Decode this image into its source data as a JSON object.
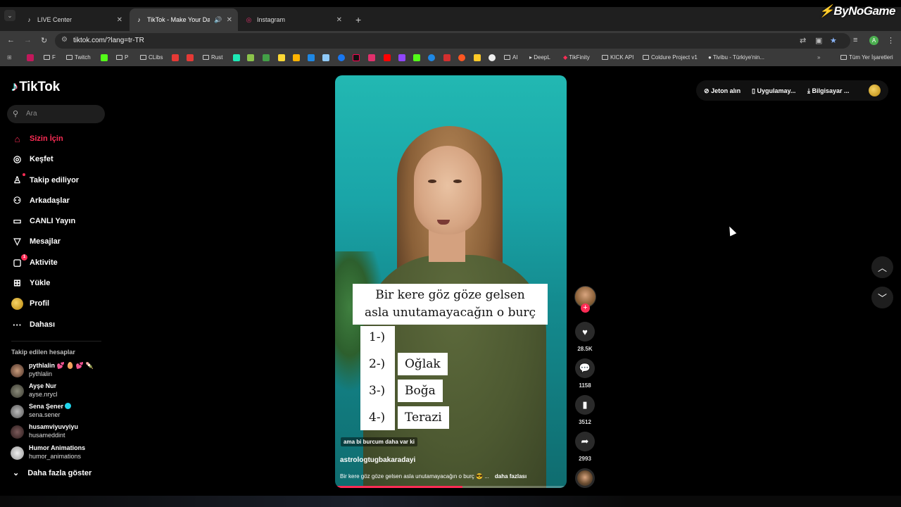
{
  "browser": {
    "tabs": [
      {
        "title": "LIVE Center",
        "icon": "tiktok-icon"
      },
      {
        "title": "TikTok - Make Your Day",
        "icon": "tiktok-icon",
        "active": true
      },
      {
        "title": "Instagram",
        "icon": "instagram-icon"
      }
    ],
    "url": "tiktok.com/?lang=tr-TR",
    "watermark": "ByNoGame",
    "bookmarks": [
      "F",
      "Twitch",
      "P",
      "CLibs",
      "Rust",
      "AI",
      "DeepL",
      "TikFinity",
      "KICK API",
      "Coldure Project v1",
      "Tivibu - Türkiye'nin...",
      "Tüm Yer İşaretleri"
    ],
    "profile_initial": "A"
  },
  "tiktok": {
    "logo": "TikTok",
    "search_placeholder": "Ara",
    "nav": [
      {
        "label": "Sizin İçin",
        "icon": "home-icon"
      },
      {
        "label": "Keşfet",
        "icon": "compass-icon"
      },
      {
        "label": "Takip ediliyor",
        "icon": "following-icon"
      },
      {
        "label": "Arkadaşlar",
        "icon": "friends-icon"
      },
      {
        "label": "CANLI Yayın",
        "icon": "live-icon"
      },
      {
        "label": "Mesajlar",
        "icon": "messages-icon"
      },
      {
        "label": "Aktivite",
        "icon": "activity-icon",
        "badge": "1"
      },
      {
        "label": "Yükle",
        "icon": "upload-icon"
      },
      {
        "label": "Profil",
        "icon": "profile-icon"
      },
      {
        "label": "Dahası",
        "icon": "more-icon"
      }
    ],
    "following_title": "Takip edilen hesaplar",
    "following": [
      {
        "name": "pythlalin 💕 🥚 💕 🍡",
        "handle": "pythlalin"
      },
      {
        "name": "Ayşe Nur",
        "handle": "ayse.nrycl"
      },
      {
        "name": "Sena Şener",
        "handle": "sena.sener",
        "verified": true
      },
      {
        "name": "husamviyuvyiyu",
        "handle": "husameddint"
      },
      {
        "name": "Humor Animations",
        "handle": "humor_animations"
      }
    ],
    "show_more": "Daha fazla göster",
    "header": {
      "coins": "Jeton alın",
      "app": "Uygulamay...",
      "desktop": "Bilgisayar ..."
    }
  },
  "video": {
    "title_line1": "Bir kere göz göze gelsen",
    "title_line2": "asla unutamayacağın o burç",
    "list": [
      {
        "num": "1-)",
        "answer": ""
      },
      {
        "num": "2-)",
        "answer": "Oğlak"
      },
      {
        "num": "3-)",
        "answer": "Boğa"
      },
      {
        "num": "4-)",
        "answer": "Terazi"
      }
    ],
    "caption_overlay": "ama bi burcum daha var ki",
    "author": "astrologtugbakaradayi",
    "description": "Bir kere göz göze gelsen asla unutamayacağın o burç 😎 ...",
    "more": "daha fazlası",
    "progress": 0.55
  },
  "actions": {
    "likes": "28.5K",
    "comments": "1158",
    "saves": "3512",
    "shares": "2993"
  }
}
